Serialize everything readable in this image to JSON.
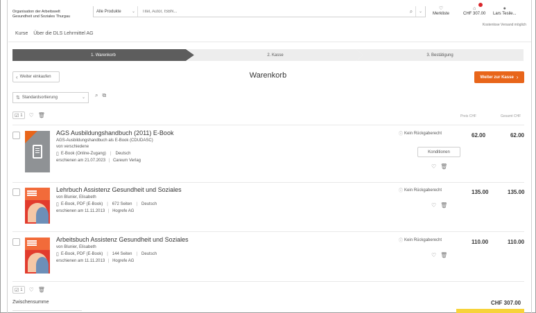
{
  "header": {
    "org_line1": "Organisation der Arbeitswelt",
    "org_line2": "Gesundheit und Soziales Thurgau",
    "search_category": "Alle Produkte",
    "search_placeholder": "Titel, Autor, ISBN...",
    "wishlist_label": "Merkliste",
    "cart_total": "CHF 307.00",
    "user_label": "Lars Tesile...",
    "free_shipping": "Kostenlose Versand möglich"
  },
  "nav": {
    "items": [
      "Kurse",
      "Über die DLS Lehrmittel AG"
    ]
  },
  "steps": [
    {
      "label": "1. Warenkorb"
    },
    {
      "label": "2. Kasse"
    },
    {
      "label": "3. Bestätigung"
    }
  ],
  "actions": {
    "back_label": "Weiter einkaufen",
    "page_title": "Warenkorb",
    "next_label": "Weiter zur Kasse"
  },
  "sort": {
    "selected": "Standardsortierung"
  },
  "table": {
    "header_count": "1",
    "col_price": "Preis CHF",
    "col_total": "Gesamt CHF"
  },
  "items": [
    {
      "title": "AGS Ausbildungshandbuch (2011) E-Book",
      "subtitle": "AGS-Ausbildungshandbuch als E-Book (CDUDASC)",
      "author": "von verschiedene",
      "format": "E-Book (Online-Zugang)",
      "language": "Deutsch",
      "pages": "",
      "date_prefix": "erschienen am",
      "date": "21.07.2023",
      "publisher": "Careum Verlag",
      "no_return": "Kein Rückgaberecht",
      "conditions": "Konditionen",
      "price": "62.00",
      "total": "62.00"
    },
    {
      "title": "Lehrbuch Assistenz Gesundheit und Soziales",
      "subtitle": "",
      "author": "von Blunier, Elisabeth",
      "format": "E-Book, PDF (E-Book)",
      "pages": "672 Seiten",
      "language": "Deutsch",
      "date_prefix": "erschienen am",
      "date": "11.11.2013",
      "publisher": "Hogrefe AG",
      "no_return": "Kein Rückgaberecht",
      "price": "135.00",
      "total": "135.00"
    },
    {
      "title": "Arbeitsbuch Assistenz Gesundheit und Soziales",
      "subtitle": "",
      "author": "von Blunier, Elisabeth",
      "format": "E-Book, PDF (E-Book)",
      "pages": "144 Seiten",
      "language": "Deutsch",
      "date_prefix": "erschienen am",
      "date": "11.11.2013",
      "publisher": "Hogrefe AG",
      "no_return": "Kein Rückgaberecht",
      "price": "110.00",
      "total": "110.00"
    }
  ],
  "footer": {
    "count": "1",
    "subtotal_label": "Zwischensumme",
    "subtotal_value": "CHF 307.00"
  },
  "colors": {
    "accent": "#e8651a",
    "step_active": "#5d5d5d",
    "step_inactive": "#ededed",
    "highlight": "#f7d33a"
  }
}
